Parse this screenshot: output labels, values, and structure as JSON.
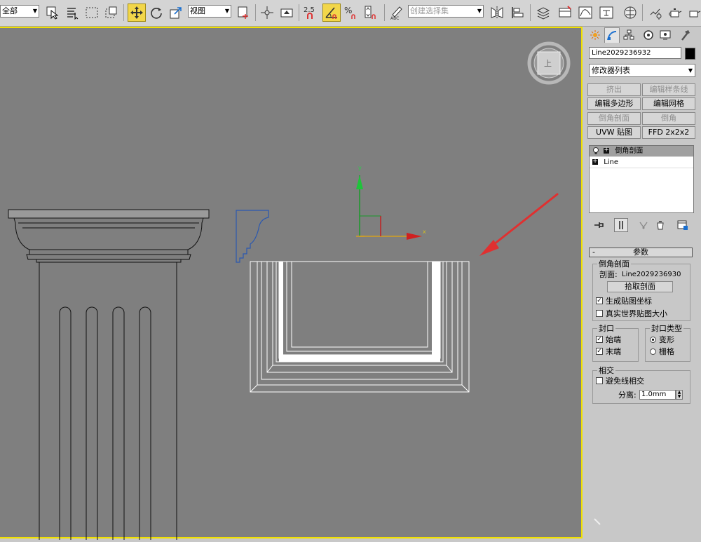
{
  "toolbar": {
    "selection_filter": "全部",
    "ref_coord": "视图",
    "named_selection_placeholder": "创建选择集",
    "snap_angle_label": "2.5",
    "percent_snap_label": "%"
  },
  "command_panel": {
    "object_name": "Line2029236932",
    "object_color": "#000000",
    "modifier_list": "修改器列表",
    "modifier_buttons": [
      {
        "label": "挤出",
        "enabled": false
      },
      {
        "label": "编辑样条线",
        "enabled": false
      },
      {
        "label": "编辑多边形",
        "enabled": true
      },
      {
        "label": "编辑网格",
        "enabled": true
      },
      {
        "label": "倒角剖面",
        "enabled": false
      },
      {
        "label": "倒角",
        "enabled": false
      },
      {
        "label": "UVW 贴图",
        "enabled": true
      },
      {
        "label": "FFD 2x2x2",
        "enabled": true
      }
    ],
    "stack": [
      {
        "label": "倒角剖面",
        "selected": true
      },
      {
        "label": "Line",
        "selected": false
      }
    ],
    "params": {
      "rollout_title": "参数",
      "bevel_profile_group": "倒角剖面",
      "profile_label": "剖面:",
      "profile_value": "Line2029236930",
      "pick_profile_button": "拾取剖面",
      "gen_map_coords": "生成贴图坐标",
      "gen_map_coords_checked": true,
      "real_world_map": "真实世界贴图大小",
      "real_world_map_checked": false,
      "capping_group": "封口",
      "cap_start": "始端",
      "cap_start_checked": true,
      "cap_end": "末端",
      "cap_end_checked": true,
      "cap_type_group": "封口类型",
      "cap_morph": "变形",
      "cap_grid": "栅格",
      "cap_type_selected": "变形",
      "intersect_group": "相交",
      "avoid_intersect": "避免线相交",
      "avoid_intersect_checked": false,
      "separation_label": "分离:",
      "separation_value": "1.0mm"
    }
  },
  "viewport": {
    "viewcube_label": "上",
    "gizmo_y_label": "y",
    "gizmo_x_label": "x",
    "background": "#7f7f7f",
    "border_color": "#f0e000",
    "arrow_color": "#e03030"
  }
}
